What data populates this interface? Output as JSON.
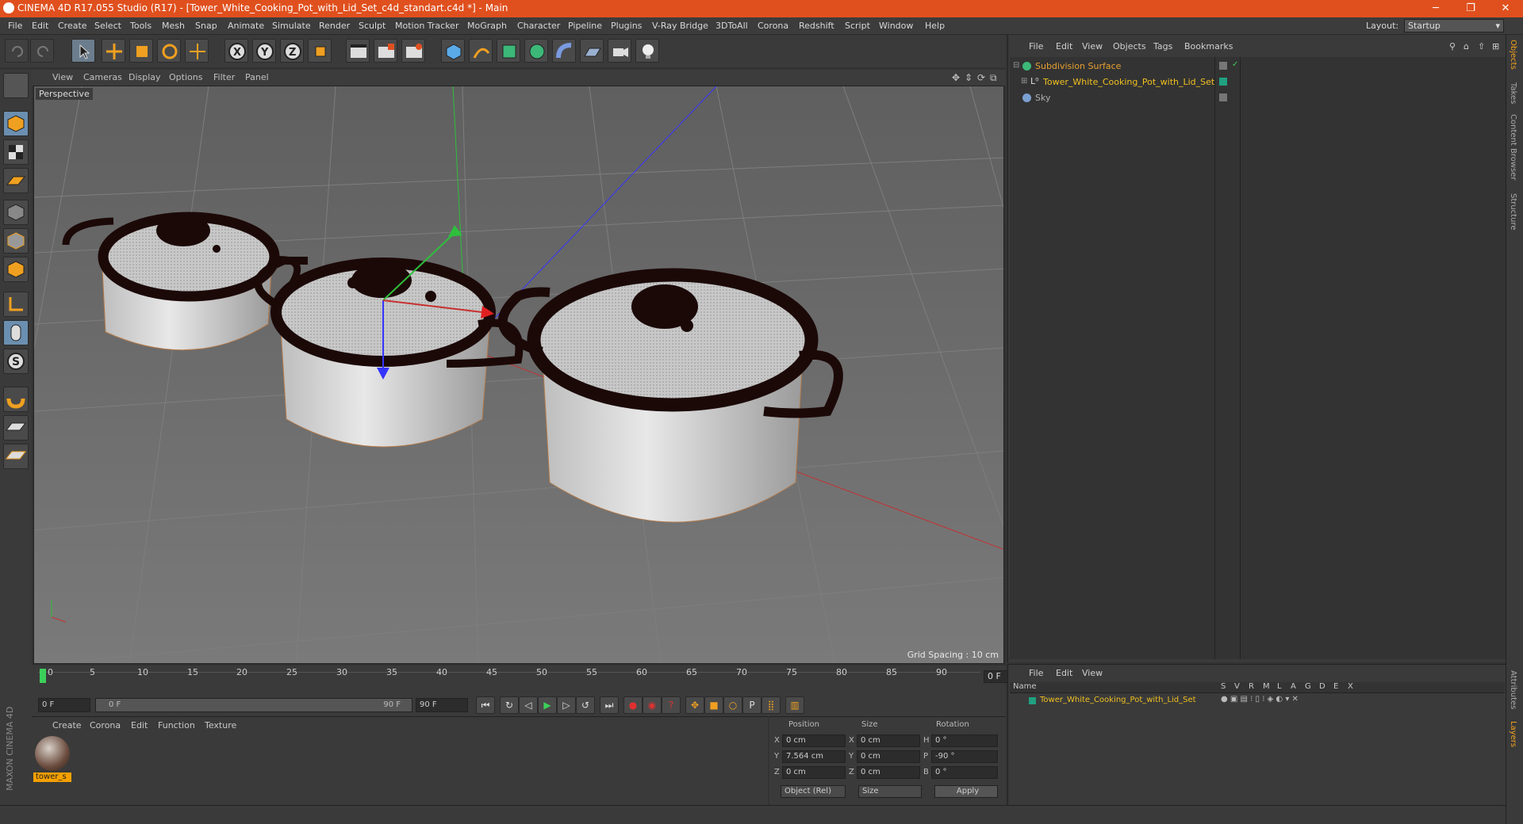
{
  "window": {
    "title": "CINEMA 4D R17.055 Studio (R17) - [Tower_White_Cooking_Pot_with_Lid_Set_c4d_standart.c4d *] - Main"
  },
  "menu": [
    "File",
    "Edit",
    "Create",
    "Select",
    "Tools",
    "Mesh",
    "Snap",
    "Animate",
    "Simulate",
    "Render",
    "Sculpt",
    "Motion Tracker",
    "MoGraph",
    "Character",
    "Pipeline",
    "Plugins",
    "V-Ray Bridge",
    "3DToAll",
    "Corona",
    "Redshift",
    "Script",
    "Window",
    "Help"
  ],
  "layout": {
    "label": "Layout:",
    "value": "Startup"
  },
  "viewport": {
    "menu": [
      "View",
      "Cameras",
      "Display",
      "Options",
      "Filter",
      "Panel"
    ],
    "label": "Perspective",
    "grid_spacing": "Grid Spacing : 10 cm"
  },
  "timeline": {
    "ticks": [
      "0",
      "5",
      "10",
      "15",
      "20",
      "25",
      "30",
      "35",
      "40",
      "45",
      "50",
      "55",
      "60",
      "65",
      "70",
      "75",
      "80",
      "85",
      "90"
    ],
    "current_frame": "0 F",
    "start_field": "0 F",
    "range_start": "0 F",
    "range_end": "90 F",
    "end_field": "90 F"
  },
  "material_panel": {
    "menu": [
      "Create",
      "Corona",
      "Edit",
      "Function",
      "Texture"
    ],
    "material_name": "tower_s"
  },
  "coords": {
    "headers": [
      "Position",
      "Size",
      "Rotation"
    ],
    "rows": [
      {
        "axis": "X",
        "pos": "0 cm",
        "saxis": "X",
        "size": "0 cm",
        "raxis": "H",
        "rot": "0 °"
      },
      {
        "axis": "Y",
        "pos": "7.564 cm",
        "saxis": "Y",
        "size": "0 cm",
        "raxis": "P",
        "rot": "-90 °"
      },
      {
        "axis": "Z",
        "pos": "0 cm",
        "saxis": "Z",
        "size": "0 cm",
        "raxis": "B",
        "rot": "0 °"
      }
    ],
    "mode": "Object (Rel)",
    "size_mode": "Size",
    "apply": "Apply"
  },
  "object_manager": {
    "menu": [
      "File",
      "Edit",
      "View",
      "Objects",
      "Tags",
      "Bookmarks"
    ],
    "objects": [
      {
        "name": "Subdivision Surface",
        "color": "#e8a030"
      },
      {
        "name": "Tower_White_Cooking_Pot_with_Lid_Set",
        "color": "#f0c020"
      },
      {
        "name": "Sky",
        "color": "#b0b0b0"
      }
    ]
  },
  "layer_manager": {
    "menu": [
      "File",
      "Edit",
      "View"
    ],
    "col_name": "Name",
    "cols": [
      "S",
      "V",
      "R",
      "M",
      "L",
      "A",
      "G",
      "D",
      "E",
      "X"
    ],
    "layer": "Tower_White_Cooking_Pot_with_Lid_Set"
  },
  "right_tabs": [
    "Objects",
    "Takes",
    "Content Browser",
    "Structure"
  ],
  "right_tabs_lower": [
    "Attributes",
    "Layers"
  ],
  "maxon_logo": "MAXON CINEMA 4D"
}
